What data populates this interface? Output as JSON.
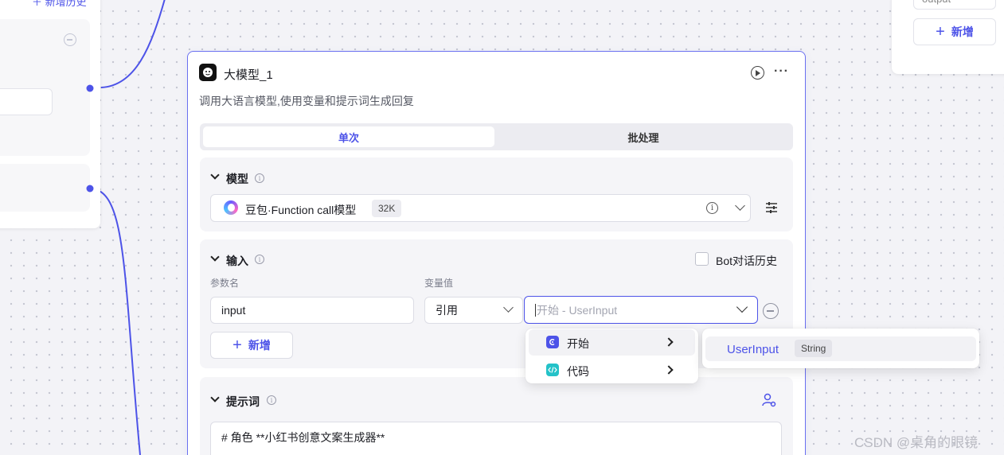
{
  "left_node": {
    "add_label": "新增历史"
  },
  "right_node": {
    "output_field": "output",
    "add_label": "新增"
  },
  "node": {
    "title": "大模型_1",
    "description": "调用大语言模型,使用变量和提示词生成回复",
    "tabs": [
      {
        "label": "单次",
        "active": true
      },
      {
        "label": "批处理",
        "active": false
      }
    ]
  },
  "model_section": {
    "title": "模型",
    "model_name": "豆包·Function call模型",
    "context_badge": "32K"
  },
  "input_section": {
    "title": "输入",
    "bot_history_label": "Bot对话历史",
    "bot_history_checked": false,
    "col_param_name": "参数名",
    "col_var_value": "变量值",
    "param_value": "input",
    "ref_type": "引用",
    "var_placeholder": "开始 - UserInput",
    "add_label": "新增"
  },
  "var_menu": {
    "items": [
      {
        "label": "开始",
        "icon": "start-icon",
        "color": "#4d53e8"
      },
      {
        "label": "代码",
        "icon": "code-icon",
        "color": "#24c2c8"
      }
    ],
    "submenu": {
      "name": "UserInput",
      "type": "String"
    }
  },
  "prompt_section": {
    "title": "提示词",
    "first_line": "# 角色 **小红书创意文案生成器**"
  },
  "watermark": "CSDN @桌角的眼镜",
  "colors": {
    "accent": "#4d53e8",
    "edge": "#4d53e8",
    "code_icon": "#24c2c8"
  }
}
